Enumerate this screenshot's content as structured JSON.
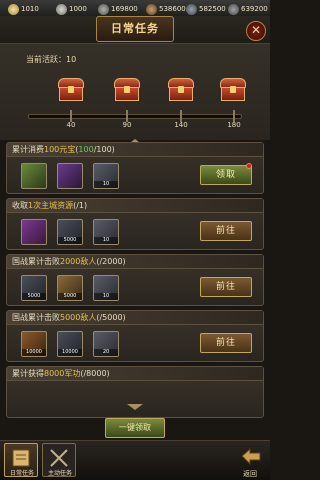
{
  "resources": [
    {
      "icon": "silver-icon",
      "value": "1010"
    },
    {
      "icon": "coin-icon",
      "value": "1000"
    },
    {
      "icon": "food-icon",
      "value": "169800"
    },
    {
      "icon": "wood-icon",
      "value": "538600"
    },
    {
      "icon": "iron-icon",
      "value": "582500"
    },
    {
      "icon": "stone-icon",
      "value": "639200"
    }
  ],
  "title": "日常任务",
  "activity": {
    "label": "当前活跃：",
    "value": "10"
  },
  "milestones": [
    "40",
    "90",
    "140",
    "180"
  ],
  "tasks": [
    {
      "prefix": "累计消费",
      "target": "100元宝",
      "progress_open": "(",
      "progress_done": "100",
      "progress_rest": "/100)",
      "button": "领取",
      "items": [
        {
          "icon": "general-portrait-icon",
          "amount": ""
        },
        {
          "icon": "general-portrait-icon",
          "amount": ""
        },
        {
          "icon": "iron-bar-icon",
          "amount": "10"
        }
      ]
    },
    {
      "prefix": "收取",
      "target": "1次主城资源",
      "progress_open": "(",
      "progress_done": "",
      "progress_rest": "/1)",
      "button": "前往",
      "items": [
        {
          "icon": "grain-icon",
          "amount": ""
        },
        {
          "icon": "iron-bar-icon",
          "amount": "5000"
        },
        {
          "icon": "iron-bar-icon",
          "amount": "10"
        }
      ]
    },
    {
      "prefix": "国战累计击败",
      "target": "2000敌人",
      "progress_open": "(",
      "progress_done": "",
      "progress_rest": "/2000)",
      "button": "前往",
      "items": [
        {
          "icon": "iron-bar-icon",
          "amount": "5000"
        },
        {
          "icon": "grain-icon",
          "amount": "5000"
        },
        {
          "icon": "iron-bar-icon",
          "amount": "10"
        }
      ]
    },
    {
      "prefix": "国战累计击败",
      "target": "5000敌人",
      "progress_open": "(",
      "progress_done": "",
      "progress_rest": "/5000)",
      "button": "前往",
      "items": [
        {
          "icon": "wood-log-icon",
          "amount": "10000"
        },
        {
          "icon": "iron-bar-icon",
          "amount": "10000"
        },
        {
          "icon": "iron-bar-icon",
          "amount": "20"
        }
      ]
    },
    {
      "prefix": "累计获得",
      "target": "8000军功",
      "progress_open": "(",
      "progress_done": "",
      "progress_rest": "/8000)",
      "button": "",
      "items": []
    }
  ],
  "claim_all": "一键领取",
  "bottom_tabs": [
    {
      "icon": "daily-task-icon",
      "label": "日常任务"
    },
    {
      "icon": "main-quest-icon",
      "label": "主动任务"
    }
  ],
  "back_label": "返回",
  "colors": {
    "accent": "#e8c050",
    "done": "#60d050",
    "button": "#5a6a28"
  }
}
